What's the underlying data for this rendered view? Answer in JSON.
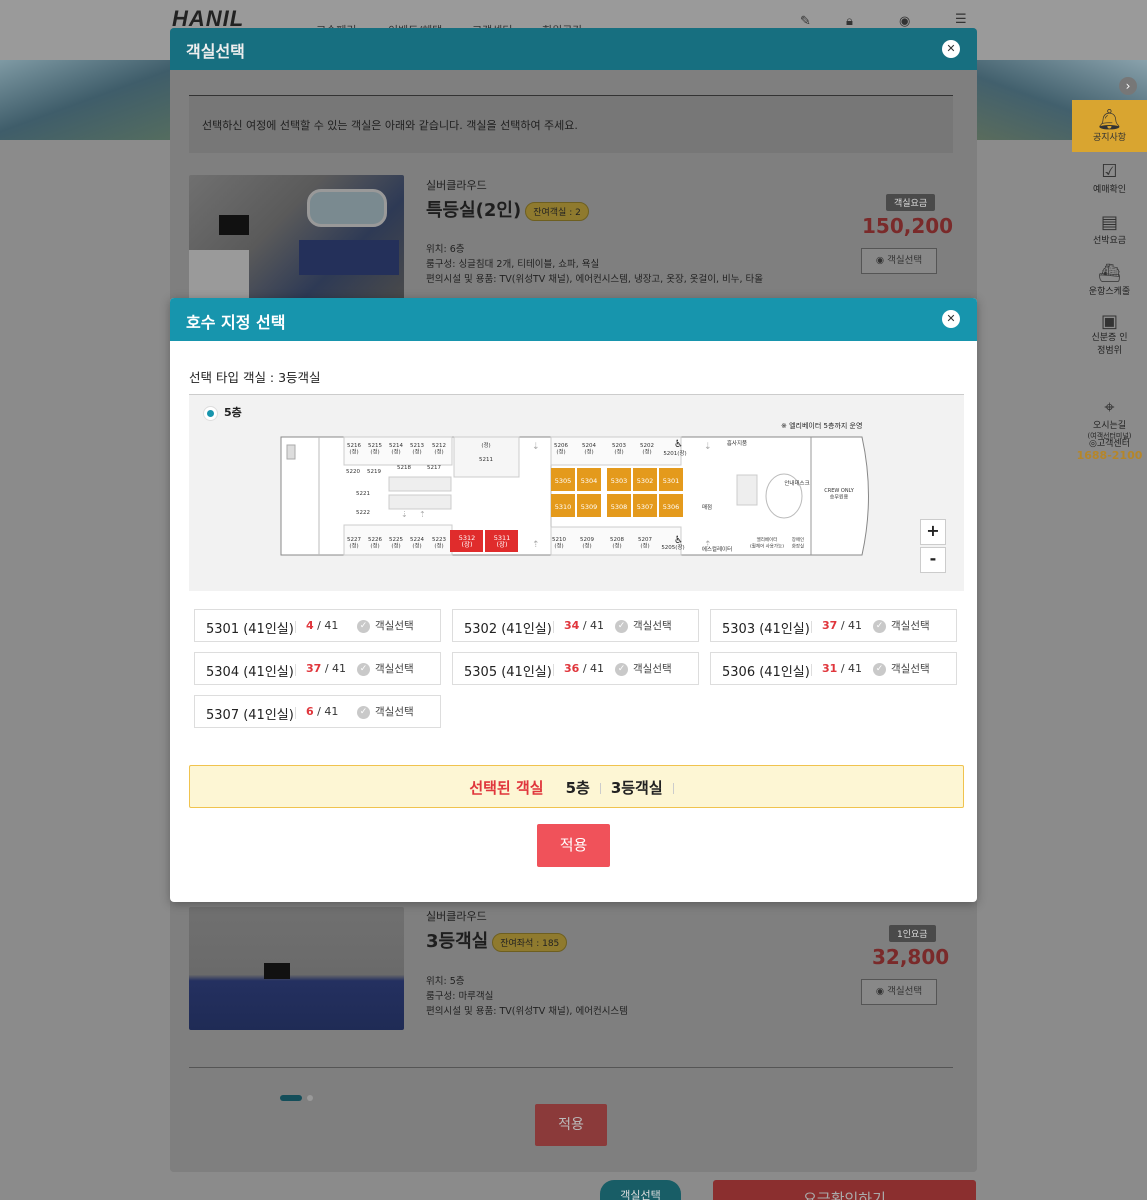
{
  "site": {
    "logo": "HANIL",
    "nav": [
      "고속페리",
      "이벤트/혜택",
      "고객센터",
      "회원공간"
    ]
  },
  "sidebar": {
    "items": [
      {
        "label": "공지사항",
        "icon": "bell-icon"
      },
      {
        "label": "예매확인",
        "icon": "check-calendar-icon"
      },
      {
        "label": "선박요금",
        "icon": "fare-icon"
      },
      {
        "label": "운항스케줄",
        "icon": "ship-icon"
      },
      {
        "label": "신분증 인정범위",
        "icon": "id-card-icon"
      },
      {
        "label": "오시는길",
        "icon": "map-icon"
      }
    ],
    "map_note": "(여객선터미널)",
    "service_label": "고객센터",
    "service_phone": "1688-2100"
  },
  "outer_modal": {
    "title": "객실선택",
    "info": "선택하신 여정에 선택할 수 있는 객실은 아래와 같습니다. 객실을 선택하여 주세요.",
    "rooms": [
      {
        "ship": "실버클라우드",
        "name": "특등실(2인)",
        "remain": "잔여객실 : 2",
        "location": "위치: 6층",
        "composition": "룸구성: 싱글침대 2개, 티테이블, 쇼파, 욕실",
        "amenities": "편의시설 및 용품: TV(위성TV 채널), 에어컨시스템, 냉장고, 옷장, 옷걸이, 비누, 타올",
        "fee_label": "객실요금",
        "price": "150,200",
        "select_label": "객실선택"
      },
      {
        "ship": "실버클라우드",
        "name": "3등객실",
        "remain": "잔여좌석 : 185",
        "location": "위치: 5층",
        "composition": "룸구성: 마루객실",
        "amenities": "편의시설 및 용품: TV(위성TV 채널), 에어컨시스템",
        "fee_label": "1인요금",
        "price": "32,800",
        "select_label": "객실선택"
      }
    ],
    "apply_label": "적용"
  },
  "bottom_bar": {
    "select_tab": "객실선택",
    "next_button": "요금확인하기"
  },
  "inner_modal": {
    "title": "호수 지정 선택",
    "subtitle": "선택 타입 객실 : 3등객실",
    "floor_label": "5층",
    "elevator_note": "※ 엘리베이터 5층까지 운영",
    "zoom_in": "+",
    "zoom_out": "-",
    "deck": {
      "top_rooms": [
        "5216\n(정)",
        "5215\n(정)",
        "5214\n(정)",
        "5213\n(정)",
        "5212\n(정)"
      ],
      "top_mid": "(정)",
      "top_mid2": "5211",
      "top_right": [
        "5206\n(정)",
        "5204\n(정)",
        "5203\n(정)",
        "5202\n(정)"
      ],
      "r5201": "5201(장)",
      "smoking": "흡사지품",
      "left_col": [
        "5220",
        "5219",
        "5218",
        "5217",
        "5221",
        "5222"
      ],
      "bottom_rooms": [
        "5227\n(정)",
        "5226\n(정)",
        "5225\n(정)",
        "5224\n(정)",
        "5223\n(정)"
      ],
      "bottom_red": [
        "5312\n(장)",
        "5311\n(장)"
      ],
      "bottom_right": [
        "5210\n(정)",
        "5209\n(정)",
        "5208\n(정)",
        "5207\n(정)"
      ],
      "r5205": "5205(장)",
      "orange_top": [
        "5305",
        "5304",
        "5303",
        "5302",
        "5301"
      ],
      "orange_bot": [
        "5310",
        "5309",
        "5308",
        "5307",
        "5306"
      ],
      "info_desk": "안내데스크",
      "shop": "매점",
      "restaurant": "에스컬레이터",
      "elevator": "엘리베이터\n(휠체어 사용가능)",
      "disabled_wc": "장애인\n화장실",
      "crew": "CREW ONLY\n승무원용"
    },
    "cabins": [
      {
        "name": "5301 (41인실)",
        "remain": "4",
        "total": "/ 41",
        "select": "객실선택"
      },
      {
        "name": "5302 (41인실)",
        "remain": "34",
        "total": "/ 41",
        "select": "객실선택"
      },
      {
        "name": "5303 (41인실)",
        "remain": "37",
        "total": "/ 41",
        "select": "객실선택"
      },
      {
        "name": "5304 (41인실)",
        "remain": "37",
        "total": "/ 41",
        "select": "객실선택"
      },
      {
        "name": "5305 (41인실)",
        "remain": "36",
        "total": "/ 41",
        "select": "객실선택"
      },
      {
        "name": "5306 (41인실)",
        "remain": "31",
        "total": "/ 41",
        "select": "객실선택"
      },
      {
        "name": "5307 (41인실)",
        "remain": "6",
        "total": "/ 41",
        "select": "객실선택"
      }
    ],
    "selected": {
      "label": "선택된 객실",
      "floor": "5층",
      "type": "3등객실"
    },
    "apply_label": "적용"
  },
  "colors": {
    "header_teal": "#1795ad",
    "accent_red": "#e0363c",
    "apply_pink": "#f0525a",
    "cabin_orange": "#e49a1c",
    "cabin_red": "#e02c2c",
    "selected_bg": "#fdf6d4"
  }
}
